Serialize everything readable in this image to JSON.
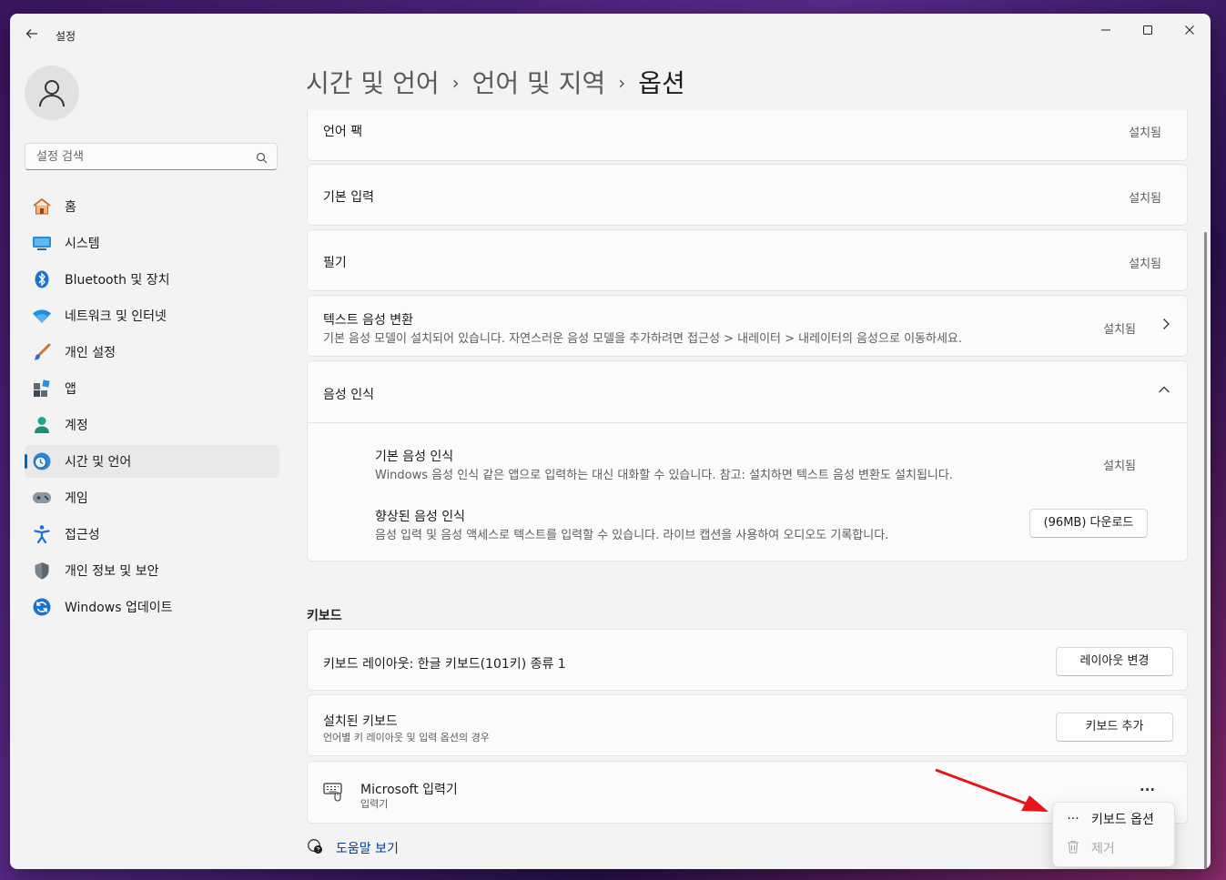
{
  "window": {
    "title": "설정",
    "controls": {
      "minimize": "—",
      "maximize": "☐",
      "close": "✕"
    }
  },
  "search": {
    "placeholder": "설정 검색"
  },
  "sidebar": {
    "items": [
      {
        "label": "홈",
        "icon": "home-icon"
      },
      {
        "label": "시스템",
        "icon": "system-icon"
      },
      {
        "label": "Bluetooth 및 장치",
        "icon": "bluetooth-icon"
      },
      {
        "label": "네트워크 및 인터넷",
        "icon": "wifi-icon"
      },
      {
        "label": "개인 설정",
        "icon": "brush-icon"
      },
      {
        "label": "앱",
        "icon": "apps-icon"
      },
      {
        "label": "계정",
        "icon": "account-icon"
      },
      {
        "label": "시간 및 언어",
        "icon": "time-language-icon",
        "active": true
      },
      {
        "label": "게임",
        "icon": "gamepad-icon"
      },
      {
        "label": "접근성",
        "icon": "accessibility-icon"
      },
      {
        "label": "개인 정보 및 보안",
        "icon": "shield-icon"
      },
      {
        "label": "Windows 업데이트",
        "icon": "update-icon"
      }
    ]
  },
  "breadcrumb": {
    "level1": "시간 및 언어",
    "level2": "언어 및 지역",
    "current": "옵션",
    "separator": "›"
  },
  "features": {
    "language_pack": {
      "title": "언어 팩",
      "status": "설치됨"
    },
    "basic_typing": {
      "title": "기본 입력",
      "status": "설치됨"
    },
    "handwriting": {
      "title": "필기",
      "status": "설치됨"
    },
    "tts": {
      "title": "텍스트 음성 변환",
      "desc": "기본 음성 모델이 설치되어 있습니다. 자연스러운 음성 모델을 추가하려면 접근성 > 내레이터 > 내레이터의 음성으로 이동하세요.",
      "status": "설치됨"
    },
    "speech": {
      "title": "음성 인식",
      "basic": {
        "title": "기본 음성 인식",
        "desc": "Windows 음성 인식 같은 앱으로 입력하는 대신 대화할 수 있습니다. 참고: 설치하면 텍스트 음성 변환도 설치됩니다.",
        "status": "설치됨"
      },
      "enhanced": {
        "title": "향상된 음성 인식",
        "desc": "음성 입력 및 음성 액세스로 텍스트를 입력할 수 있습니다. 라이브 캡션을 사용하여 오디오도 기록합니다.",
        "button": "(96MB) 다운로드"
      }
    }
  },
  "keyboard": {
    "section_label": "키보드",
    "layout": {
      "title": "키보드 레이아웃: 한글 키보드(101키) 종류 1",
      "button": "레이아웃 변경"
    },
    "installed": {
      "title": "설치된 키보드",
      "desc": "언어별 키 레이아웃 및 입력 옵션의 경우",
      "button": "키보드 추가"
    },
    "ime": {
      "title": "Microsoft 입력기",
      "subtitle": "입력기",
      "more": "···"
    }
  },
  "context_menu": {
    "items": [
      {
        "label": "키보드 옵션",
        "icon": "more-icon",
        "glyph": "···",
        "enabled": true
      },
      {
        "label": "제거",
        "icon": "trash-icon",
        "enabled": false
      }
    ]
  },
  "help": {
    "label": "도움말 보기"
  },
  "colors": {
    "accent": "#0067c0",
    "annotation_arrow": "#e8141b"
  }
}
